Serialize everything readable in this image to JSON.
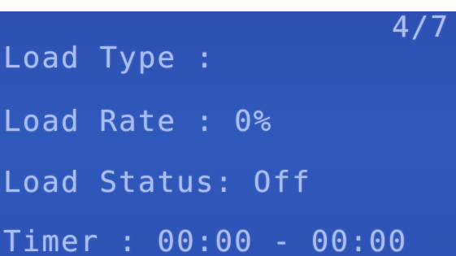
{
  "screen": {
    "page_indicator": "4/7",
    "rows": [
      {
        "label": "Load Type :",
        "value": ""
      },
      {
        "label": "Load Rate : ",
        "value": "0%"
      },
      {
        "label": "Load Status: ",
        "value": "Off"
      },
      {
        "label": "Timer : ",
        "value": "00:00 - 00:00"
      }
    ],
    "colors": {
      "background": "#2f54b8",
      "text": "#a9bdf0"
    }
  }
}
